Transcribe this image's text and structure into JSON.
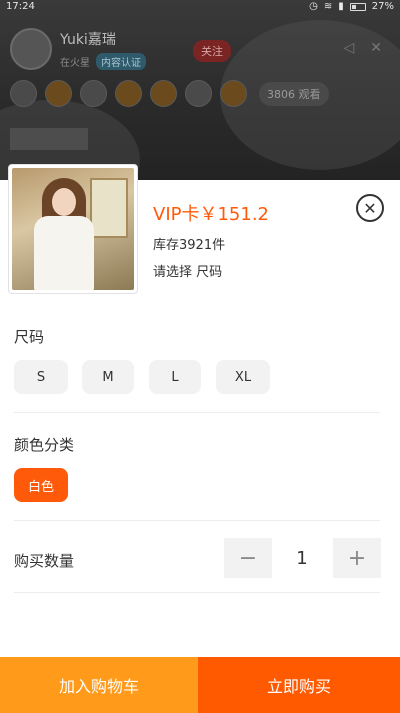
{
  "status_bar": {
    "time": "17:24",
    "battery": "27%"
  },
  "stream": {
    "host_name": "Yuki嘉瑞",
    "host_tag": "在火星",
    "host_badge": "内容认证",
    "follow_label": "关注",
    "viewer_count": "3806 观看"
  },
  "product": {
    "price": "VIP卡￥151.2",
    "stock": "库存3921件",
    "prompt": "请选择 尺码"
  },
  "size": {
    "title": "尺码",
    "options": [
      "S",
      "M",
      "L",
      "XL"
    ]
  },
  "color": {
    "title": "颜色分类",
    "options": [
      "白色"
    ]
  },
  "quantity": {
    "title": "购买数量",
    "value": "1",
    "decrement": "−",
    "increment": "+"
  },
  "actions": {
    "add_to_cart": "加入购物车",
    "buy_now": "立即购买"
  },
  "colors": {
    "accent": "#ff5a0a",
    "cart": "#ff9a1a",
    "buy": "#ff5a00"
  }
}
